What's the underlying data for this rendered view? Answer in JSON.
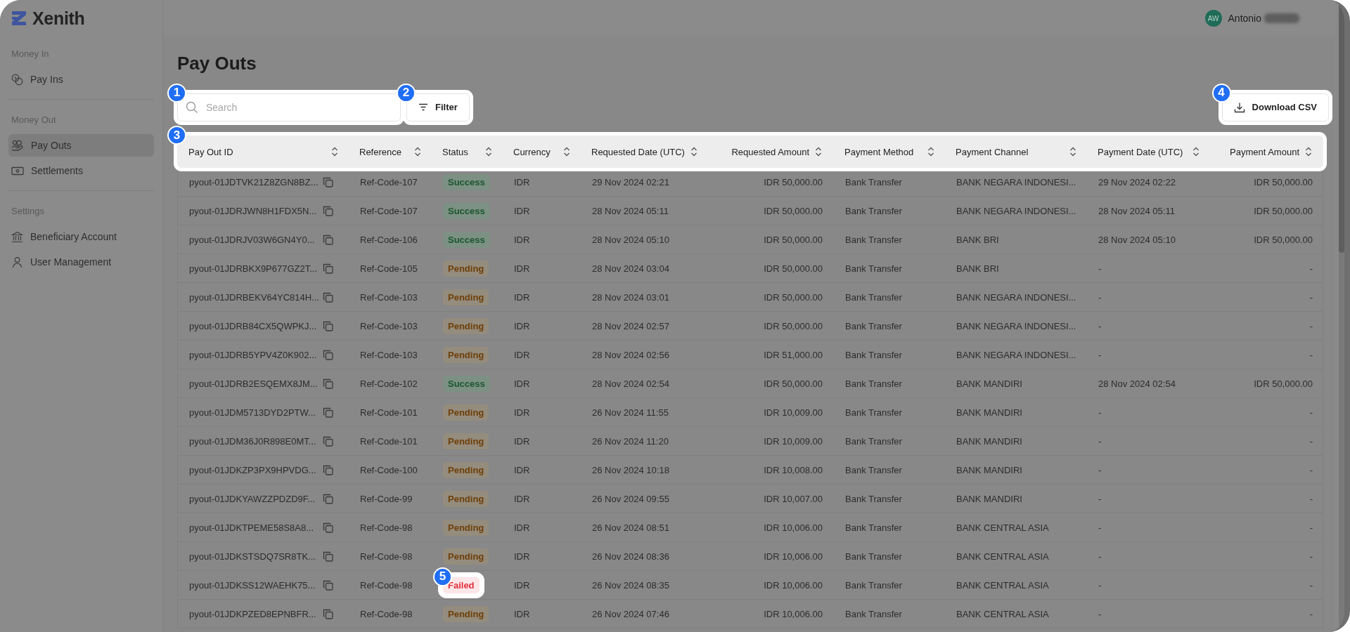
{
  "app": {
    "logo_text": "Xenith"
  },
  "user": {
    "initials": "AW",
    "name": "Antonio"
  },
  "sidebar": {
    "sections": [
      {
        "label": "Money In",
        "items": [
          {
            "label": "Pay Ins",
            "selected": false
          }
        ]
      },
      {
        "label": "Money Out",
        "items": [
          {
            "label": "Pay Outs",
            "selected": true
          },
          {
            "label": "Settlements",
            "selected": false
          }
        ]
      },
      {
        "label": "Settings",
        "items": [
          {
            "label": "Beneficiary Account",
            "selected": false
          },
          {
            "label": "User Management",
            "selected": false
          }
        ]
      }
    ]
  },
  "page": {
    "title": "Pay Outs"
  },
  "search": {
    "placeholder": "Search",
    "callout": "1"
  },
  "filter_button": {
    "label": "Filter",
    "callout": "2"
  },
  "download_button": {
    "label": "Download CSV",
    "callout": "4"
  },
  "table": {
    "callout": "3",
    "columns": [
      {
        "label": "Pay Out ID"
      },
      {
        "label": "Reference"
      },
      {
        "label": "Status"
      },
      {
        "label": "Currency"
      },
      {
        "label": "Requested Date (UTC)"
      },
      {
        "label": "Requested Amount"
      },
      {
        "label": "Payment Method"
      },
      {
        "label": "Payment Channel"
      },
      {
        "label": "Payment Date (UTC)"
      },
      {
        "label": "Payment Amount"
      }
    ],
    "rows": [
      {
        "id": "pyout-01JDTVK21Z8ZGN8BZ...",
        "reference": "Ref-Code-107",
        "status": {
          "label": "Success",
          "kind": "success"
        },
        "currency": "IDR",
        "requested_date": "29 Nov 2024 02:21",
        "requested_amount": "IDR 50,000.00",
        "payment_method": "Bank Transfer",
        "payment_channel": "BANK NEGARA INDONESI...",
        "payment_date": "29 Nov 2024 02:22",
        "payment_amount": "IDR 50,000.00"
      },
      {
        "id": "pyout-01JDRJWN8H1FDX5N...",
        "reference": "Ref-Code-107",
        "status": {
          "label": "Success",
          "kind": "success"
        },
        "currency": "IDR",
        "requested_date": "28 Nov 2024 05:11",
        "requested_amount": "IDR 50,000.00",
        "payment_method": "Bank Transfer",
        "payment_channel": "BANK NEGARA INDONESI...",
        "payment_date": "28 Nov 2024 05:11",
        "payment_amount": "IDR 50,000.00"
      },
      {
        "id": "pyout-01JDRJV03W6GN4Y0...",
        "reference": "Ref-Code-106",
        "status": {
          "label": "Success",
          "kind": "success"
        },
        "currency": "IDR",
        "requested_date": "28 Nov 2024 05:10",
        "requested_amount": "IDR 50,000.00",
        "payment_method": "Bank Transfer",
        "payment_channel": "BANK BRI",
        "payment_date": "28 Nov 2024 05:10",
        "payment_amount": "IDR 50,000.00"
      },
      {
        "id": "pyout-01JDRBKX9P677GZ2T...",
        "reference": "Ref-Code-105",
        "status": {
          "label": "Pending",
          "kind": "pending"
        },
        "currency": "IDR",
        "requested_date": "28 Nov 2024 03:04",
        "requested_amount": "IDR 50,000.00",
        "payment_method": "Bank Transfer",
        "payment_channel": "BANK BRI",
        "payment_date": "-",
        "payment_amount": "-"
      },
      {
        "id": "pyout-01JDRBEKV64YC814H...",
        "reference": "Ref-Code-103",
        "status": {
          "label": "Pending",
          "kind": "pending"
        },
        "currency": "IDR",
        "requested_date": "28 Nov 2024 03:01",
        "requested_amount": "IDR 50,000.00",
        "payment_method": "Bank Transfer",
        "payment_channel": "BANK NEGARA INDONESI...",
        "payment_date": "-",
        "payment_amount": "-"
      },
      {
        "id": "pyout-01JDRB84CX5QWPKJ...",
        "reference": "Ref-Code-103",
        "status": {
          "label": "Pending",
          "kind": "pending"
        },
        "currency": "IDR",
        "requested_date": "28 Nov 2024 02:57",
        "requested_amount": "IDR 50,000.00",
        "payment_method": "Bank Transfer",
        "payment_channel": "BANK NEGARA INDONESI...",
        "payment_date": "-",
        "payment_amount": "-"
      },
      {
        "id": "pyout-01JDRB5YPV4Z0K902...",
        "reference": "Ref-Code-103",
        "status": {
          "label": "Pending",
          "kind": "pending"
        },
        "currency": "IDR",
        "requested_date": "28 Nov 2024 02:56",
        "requested_amount": "IDR 51,000.00",
        "payment_method": "Bank Transfer",
        "payment_channel": "BANK NEGARA INDONESI...",
        "payment_date": "-",
        "payment_amount": "-"
      },
      {
        "id": "pyout-01JDRB2ESQEMX8JM...",
        "reference": "Ref-Code-102",
        "status": {
          "label": "Success",
          "kind": "success"
        },
        "currency": "IDR",
        "requested_date": "28 Nov 2024 02:54",
        "requested_amount": "IDR 50,000.00",
        "payment_method": "Bank Transfer",
        "payment_channel": "BANK MANDIRI",
        "payment_date": "28 Nov 2024 02:54",
        "payment_amount": "IDR 50,000.00"
      },
      {
        "id": "pyout-01JDM5713DYD2PTW...",
        "reference": "Ref-Code-101",
        "status": {
          "label": "Pending",
          "kind": "pending"
        },
        "currency": "IDR",
        "requested_date": "26 Nov 2024 11:55",
        "requested_amount": "IDR 10,009.00",
        "payment_method": "Bank Transfer",
        "payment_channel": "BANK MANDIRI",
        "payment_date": "-",
        "payment_amount": "-"
      },
      {
        "id": "pyout-01JDM36J0R898E0MT...",
        "reference": "Ref-Code-101",
        "status": {
          "label": "Pending",
          "kind": "pending"
        },
        "currency": "IDR",
        "requested_date": "26 Nov 2024 11:20",
        "requested_amount": "IDR 10,009.00",
        "payment_method": "Bank Transfer",
        "payment_channel": "BANK MANDIRI",
        "payment_date": "-",
        "payment_amount": "-"
      },
      {
        "id": "pyout-01JDKZP3PX9HPVDG...",
        "reference": "Ref-Code-100",
        "status": {
          "label": "Pending",
          "kind": "pending"
        },
        "currency": "IDR",
        "requested_date": "26 Nov 2024 10:18",
        "requested_amount": "IDR 10,008.00",
        "payment_method": "Bank Transfer",
        "payment_channel": "BANK MANDIRI",
        "payment_date": "-",
        "payment_amount": "-"
      },
      {
        "id": "pyout-01JDKYAWZZPDZD9F...",
        "reference": "Ref-Code-99",
        "status": {
          "label": "Pending",
          "kind": "pending"
        },
        "currency": "IDR",
        "requested_date": "26 Nov 2024 09:55",
        "requested_amount": "IDR 10,007.00",
        "payment_method": "Bank Transfer",
        "payment_channel": "BANK MANDIRI",
        "payment_date": "-",
        "payment_amount": "-"
      },
      {
        "id": "pyout-01JDKTPEME58S8A8...",
        "reference": "Ref-Code-98",
        "status": {
          "label": "Pending",
          "kind": "pending"
        },
        "currency": "IDR",
        "requested_date": "26 Nov 2024 08:51",
        "requested_amount": "IDR 10,006.00",
        "payment_method": "Bank Transfer",
        "payment_channel": "BANK CENTRAL ASIA",
        "payment_date": "-",
        "payment_amount": "-"
      },
      {
        "id": "pyout-01JDKSTSDQ7SR8TK...",
        "reference": "Ref-Code-98",
        "status": {
          "label": "Pending",
          "kind": "pending"
        },
        "currency": "IDR",
        "requested_date": "26 Nov 2024 08:36",
        "requested_amount": "IDR 10,006.00",
        "payment_method": "Bank Transfer",
        "payment_channel": "BANK CENTRAL ASIA",
        "payment_date": "-",
        "payment_amount": "-"
      },
      {
        "id": "pyout-01JDKSS12WAEHK75...",
        "reference": "Ref-Code-98",
        "status": {
          "label": "Failed",
          "kind": "failed",
          "callout": "5"
        },
        "currency": "IDR",
        "requested_date": "26 Nov 2024 08:35",
        "requested_amount": "IDR 10,006.00",
        "payment_method": "Bank Transfer",
        "payment_channel": "BANK CENTRAL ASIA",
        "payment_date": "-",
        "payment_amount": "-"
      },
      {
        "id": "pyout-01JDKPZED8EPNBFR...",
        "reference": "Ref-Code-98",
        "status": {
          "label": "Pending",
          "kind": "pending"
        },
        "currency": "IDR",
        "requested_date": "26 Nov 2024 07:46",
        "requested_amount": "IDR 10,006.00",
        "payment_method": "Bank Transfer",
        "payment_channel": "BANK CENTRAL ASIA",
        "payment_date": "-",
        "payment_amount": "-"
      }
    ]
  }
}
